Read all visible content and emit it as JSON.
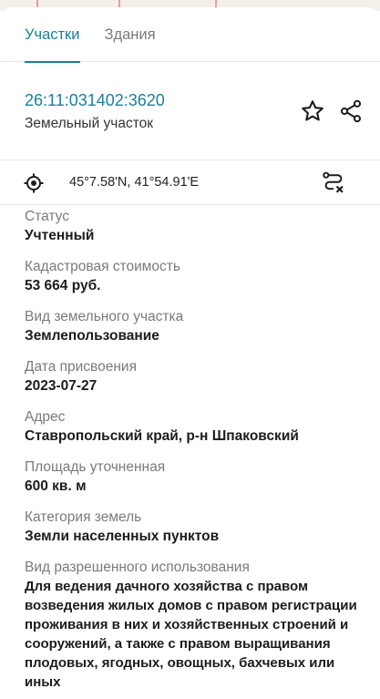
{
  "colors": {
    "accent": "#1a7f9b",
    "label": "#7a7a7a",
    "value": "#1c1c1c"
  },
  "tabs": [
    {
      "label": "Участки",
      "active": true
    },
    {
      "label": "Здания",
      "active": false
    }
  ],
  "parcel": {
    "cadastral_number": "26:11:031402:3620",
    "type": "Земельный участок",
    "favorite_icon": "star-outline-icon",
    "share_icon": "share-icon"
  },
  "coords": {
    "locate_icon": "crosshair-icon",
    "text": "45°7.58'N, 41°54.91'E",
    "route_icon": "route-clear-icon"
  },
  "fields": [
    {
      "label": "Статус",
      "value": "Учтенный"
    },
    {
      "label": "Кадастровая стоимость",
      "value": "53 664 руб."
    },
    {
      "label": "Вид земельного участка",
      "value": "Землепользование"
    },
    {
      "label": "Дата присвоения",
      "value": "2023-07-27"
    },
    {
      "label": "Адрес",
      "value": "Ставропольский край, р-н Шпаковский"
    },
    {
      "label": "Площадь уточненная",
      "value": "600 кв. м"
    },
    {
      "label": "Категория земель",
      "value": "Земли населенных пунктов"
    },
    {
      "label": "Вид разрешенного использования",
      "value": "Для ведения дачного хозяйства с правом возведения жилых домов с правом регистрации проживания в них и хозяйственных строений и сооружений, а также с правом выращивания плодовых, ягодных, овощных, бахчевых или иных"
    }
  ]
}
